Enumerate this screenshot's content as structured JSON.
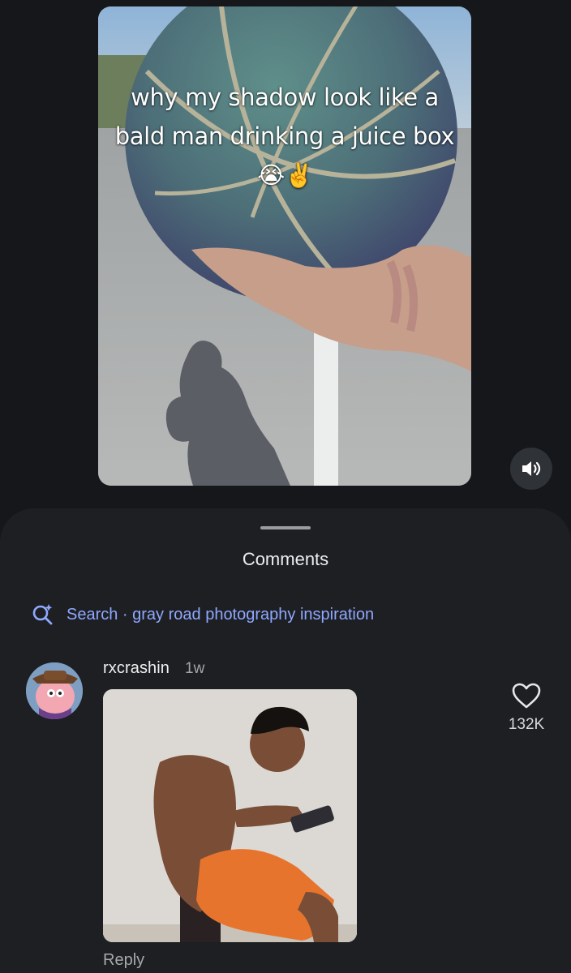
{
  "video": {
    "caption_text": "why my shadow look like a bald man drinking a juice box",
    "caption_emojis": "😭✌️",
    "mute_icon": "speaker-volume-icon"
  },
  "comments_sheet": {
    "title": "Comments",
    "search": {
      "icon": "sparkle-search-icon",
      "label": "Search · gray road photography inspiration"
    },
    "comments": [
      {
        "username": "rxcrashin",
        "time": "1w",
        "reply_label": "Reply",
        "like_icon": "heart-icon",
        "like_count": "132K"
      }
    ]
  },
  "colors": {
    "background": "#15171b",
    "sheet": "#1d1f23",
    "accent_link": "#8fa8ff"
  }
}
